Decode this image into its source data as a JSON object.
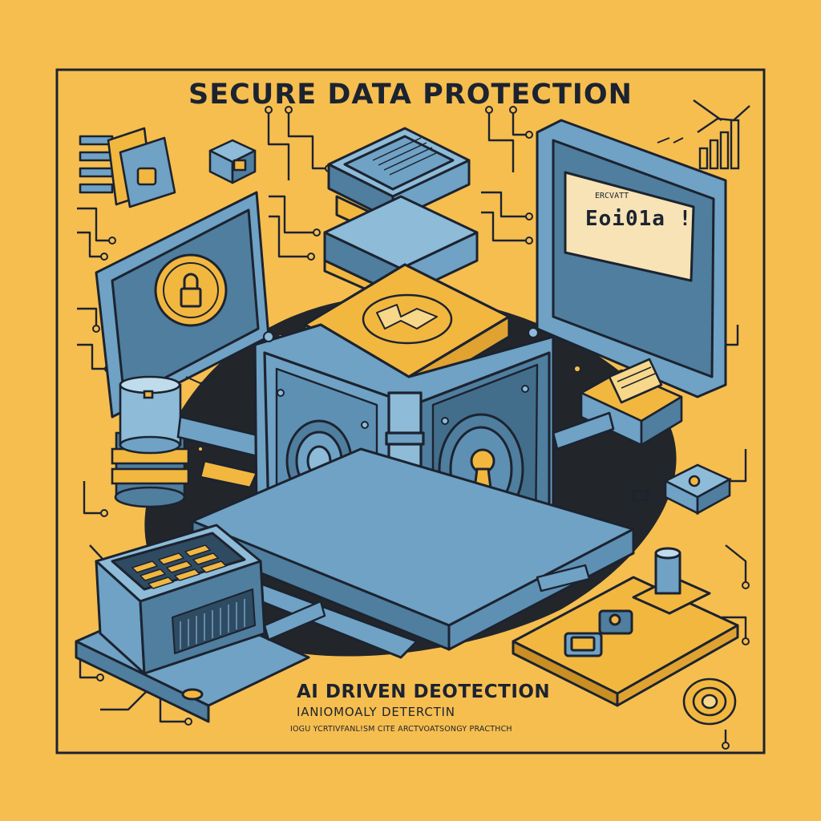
{
  "poster": {
    "title": "SECURE DATA PROTECTION",
    "tagline_primary": "AI DRIVEN DEOTECTION",
    "tagline_secondary": "IANIOMOALY DETERCTIN",
    "tagline_fine": "IOGU YCRTIVFANL!SM CITE ARCTVOATSONGY PRACTHCH"
  },
  "monitor": {
    "label_small": "ERCVATT",
    "label_large": "Eoi01a !"
  },
  "palette": {
    "background": "#F6BE4F",
    "steel_blue": "#6FA2C4",
    "steel_blue_shadow": "#4F7E9E",
    "gold": "#F2B73F",
    "outline": "#1C2330",
    "base_shadow": "#22262B"
  },
  "icons": [
    "padlock-icon",
    "keyhole-icon",
    "vault-dial-icon",
    "bar-chart-icon",
    "circuit-trace-icon",
    "server-rack-icon",
    "data-crate-icon"
  ]
}
